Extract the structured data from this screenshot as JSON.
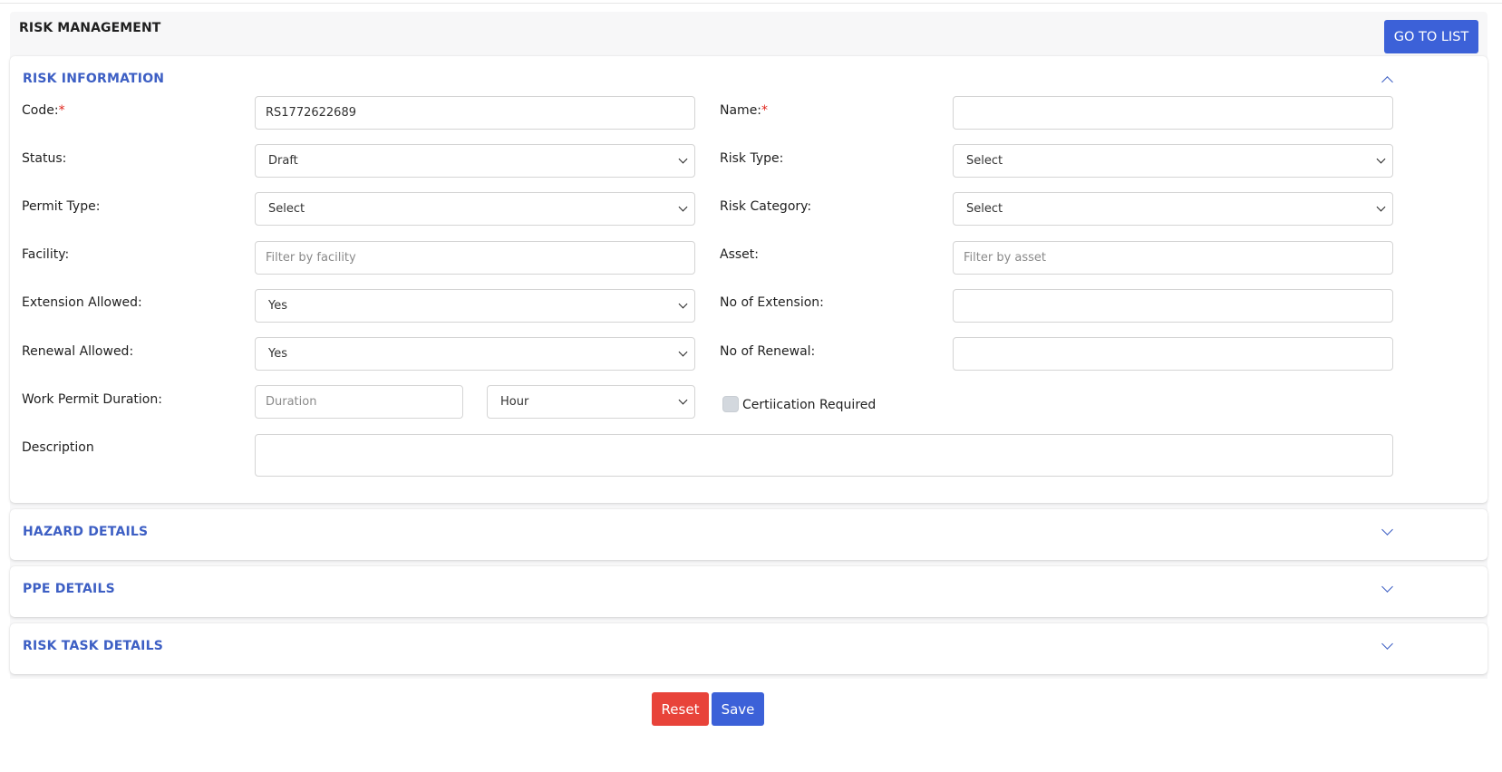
{
  "page": {
    "title": "RISK MANAGEMENT",
    "go_to_list_label": "GO TO LIST"
  },
  "risk_information": {
    "title": "RISK INFORMATION",
    "expanded": true,
    "fields": {
      "code": {
        "label": "Code:",
        "required": "*",
        "value": "RS1772622689"
      },
      "name": {
        "label": "Name:",
        "required": "*",
        "value": ""
      },
      "status": {
        "label": "Status:",
        "selected": "Draft"
      },
      "risk_type": {
        "label": "Risk Type:",
        "selected": "Select"
      },
      "permit_type": {
        "label": "Permit Type:",
        "selected": "Select"
      },
      "risk_category": {
        "label": "Risk Category:",
        "selected": "Select"
      },
      "facility": {
        "label": "Facility:",
        "placeholder": "Filter by facility",
        "value": ""
      },
      "asset": {
        "label": "Asset:",
        "placeholder": "Filter by asset",
        "value": ""
      },
      "extension_allowed": {
        "label": "Extension Allowed:",
        "selected": "Yes"
      },
      "no_of_extension": {
        "label": "No of Extension:",
        "value": ""
      },
      "renewal_allowed": {
        "label": "Renewal Allowed:",
        "selected": "Yes"
      },
      "no_of_renewal": {
        "label": "No of Renewal:",
        "value": ""
      },
      "work_permit_duration": {
        "label": "Work Permit Duration:",
        "placeholder": "Duration",
        "value": "",
        "unit_selected": "Hour"
      },
      "certification_required": {
        "label": "Certiication Required",
        "checked": false
      },
      "description": {
        "label": "Description",
        "value": ""
      }
    }
  },
  "sections": {
    "hazard": {
      "title": "HAZARD DETAILS",
      "expanded": false
    },
    "ppe": {
      "title": "PPE DETAILS",
      "expanded": false
    },
    "risk_task": {
      "title": "RISK TASK DETAILS",
      "expanded": false
    }
  },
  "footer": {
    "reset_label": "Reset",
    "save_label": "Save"
  },
  "colors": {
    "primary": "#3c61d8",
    "danger": "#e8433a",
    "section_title": "#3d5fc4",
    "required": "#e0241b"
  },
  "icons": {
    "collapse": "chevron-up-icon",
    "expand": "chevron-down-icon",
    "select_arrow": "chevron-down-icon"
  }
}
